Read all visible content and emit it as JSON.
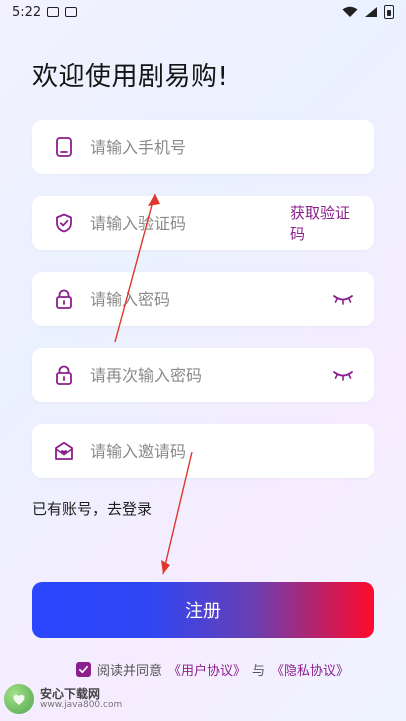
{
  "status_bar": {
    "time": "5:22"
  },
  "page": {
    "title": "欢迎使用剧易购!"
  },
  "form": {
    "phone": {
      "placeholder": "请输入手机号"
    },
    "code": {
      "placeholder": "请输入验证码",
      "action_label": "获取验证码"
    },
    "password": {
      "placeholder": "请输入密码"
    },
    "password_confirm": {
      "placeholder": "请再次输入密码"
    },
    "invite": {
      "placeholder": "请输入邀请码"
    }
  },
  "links": {
    "login": "已有账号，去登录"
  },
  "actions": {
    "register_label": "注册"
  },
  "agreement": {
    "prefix": "阅读并同意",
    "user_agreement": "《用户协议》",
    "conjunction": "与",
    "privacy_agreement": "《隐私协议》",
    "checked": true
  },
  "watermark": {
    "title": "安心下载网",
    "url": "www.java800.com"
  },
  "colors": {
    "accent": "#8b1f8c",
    "button_gradient_start": "#2a46ff",
    "button_gradient_end": "#ff0a2a",
    "annotation_arrow": "#e0362e"
  }
}
